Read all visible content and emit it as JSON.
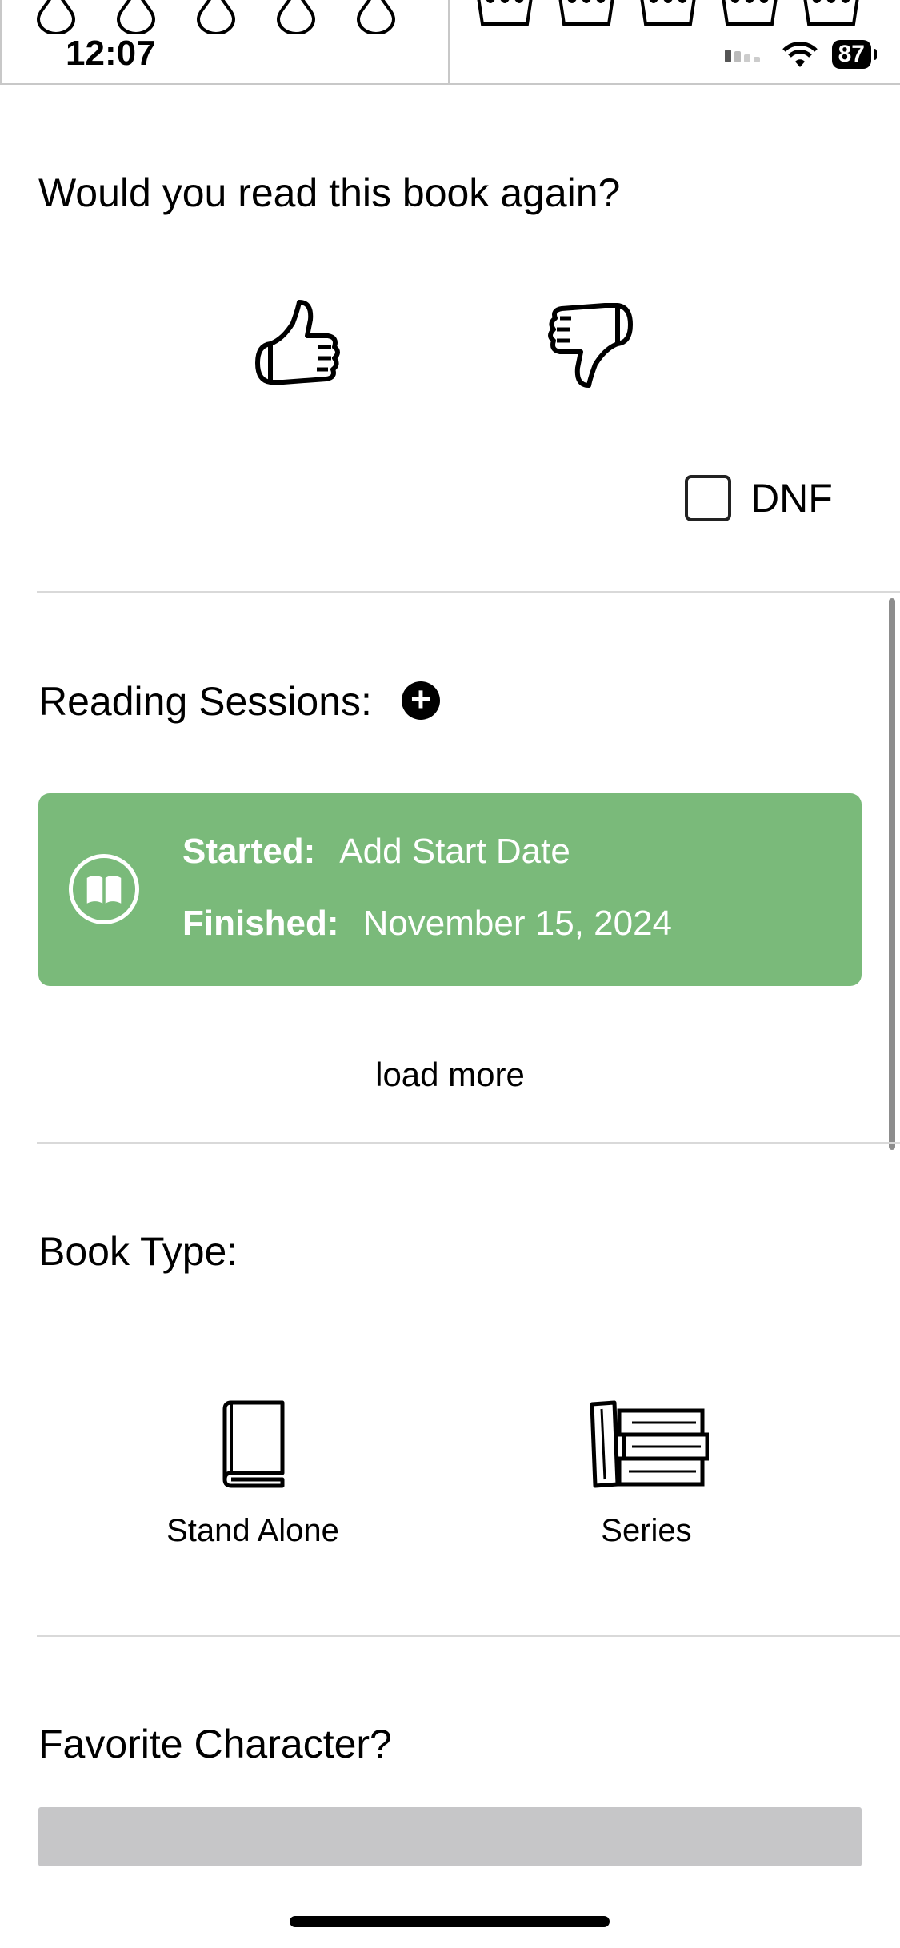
{
  "status_bar": {
    "time": "12:07",
    "battery": "87"
  },
  "reread": {
    "question": "Would you read this book again?",
    "dnf_label": "DNF"
  },
  "sessions": {
    "heading": "Reading Sessions:",
    "started_label": "Started:",
    "started_value": "Add Start Date",
    "finished_label": "Finished:",
    "finished_value": "November 15, 2024",
    "load_more": "load more",
    "card_color": "#7aba7a"
  },
  "book_type": {
    "heading": "Book Type:",
    "options": [
      {
        "label": "Stand Alone",
        "icon": "book-icon"
      },
      {
        "label": "Series",
        "icon": "books-stack-icon"
      }
    ]
  },
  "favorite_character": {
    "heading": "Favorite Character?",
    "value": ""
  }
}
